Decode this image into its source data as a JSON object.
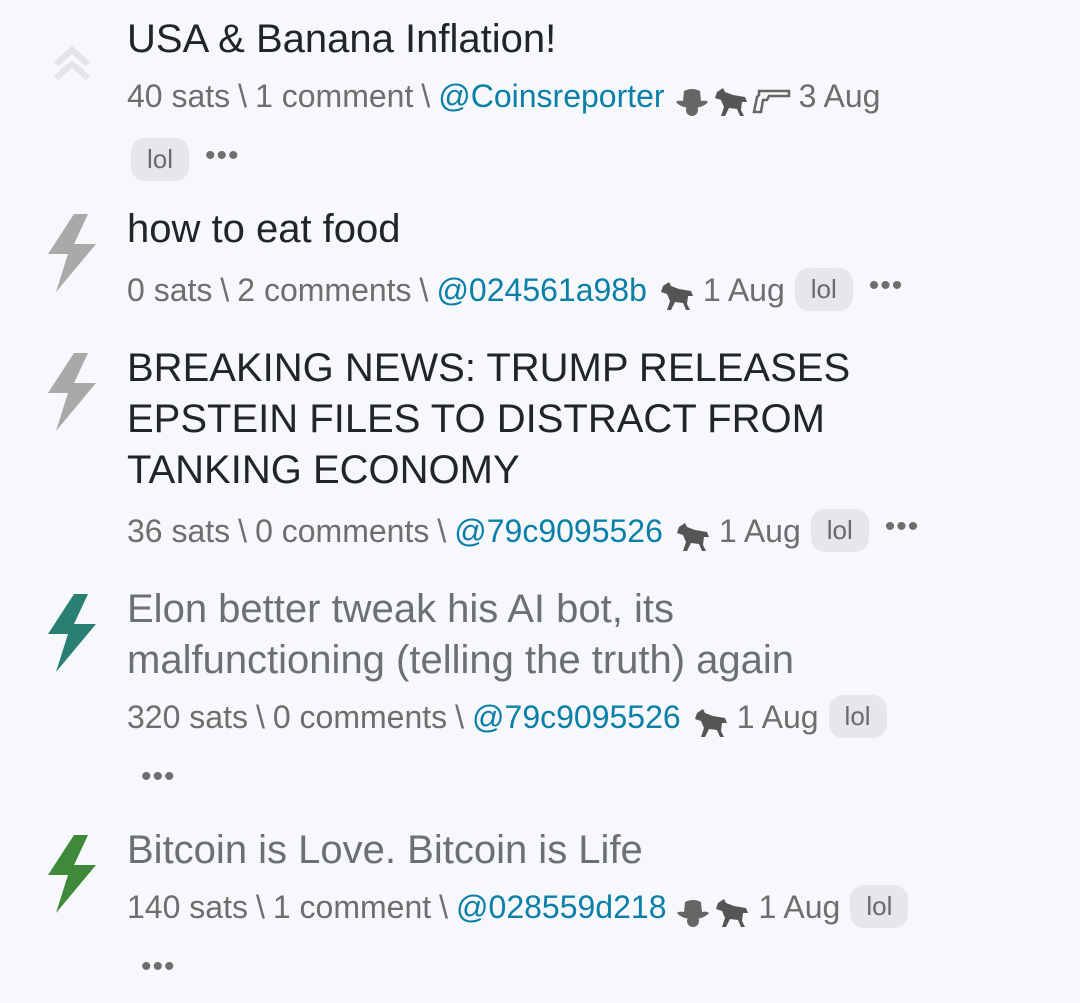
{
  "posts": [
    {
      "title": "USA & Banana Inflation!",
      "sats": "40 sats",
      "comments": "1 comment",
      "author": "@Coinsreporter",
      "date": "3 Aug",
      "tag": "lol",
      "more": "•••",
      "vote_icon": "double-chevron-up-icon",
      "badges": [
        "cowboy-hat-icon",
        "horse-icon",
        "gun-icon"
      ]
    },
    {
      "title": "how to eat food",
      "sats": "0 sats",
      "comments": "2 comments",
      "author": "@024561a98b",
      "date": "1 Aug",
      "tag": "lol",
      "more": "•••",
      "vote_icon": "lightning-bolt-icon",
      "vote_color": "#a9a9a9",
      "badges": [
        "horse-icon"
      ]
    },
    {
      "title": "BREAKING NEWS: TRUMP RELEASES EPSTEIN FILES TO DISTRACT FROM TANKING ECONOMY",
      "sats": "36 sats",
      "comments": "0 comments",
      "author": "@79c9095526",
      "date": "1 Aug",
      "tag": "lol",
      "more": "•••",
      "vote_icon": "lightning-bolt-icon",
      "vote_color": "#a9a9a9",
      "badges": [
        "horse-icon"
      ]
    },
    {
      "title": "Elon better tweak his AI bot, its malfunctioning (telling the truth) again",
      "sats": "320 sats",
      "comments": "0 comments",
      "author": "@79c9095526",
      "date": "1 Aug",
      "tag": "lol",
      "more": "•••",
      "vote_icon": "lightning-bolt-icon",
      "vote_color": "#2a7f73",
      "badges": [
        "horse-icon"
      ]
    },
    {
      "title": "Bitcoin is Love. Bitcoin is Life",
      "sats": "140 sats",
      "comments": "1 comment",
      "author": "@028559d218",
      "date": "1 Aug",
      "tag": "lol",
      "more": "•••",
      "vote_icon": "lightning-bolt-icon",
      "vote_color": "#3e8a3a",
      "badges": [
        "cowboy-hat-icon",
        "horse-icon"
      ]
    }
  ],
  "separator": "\\"
}
